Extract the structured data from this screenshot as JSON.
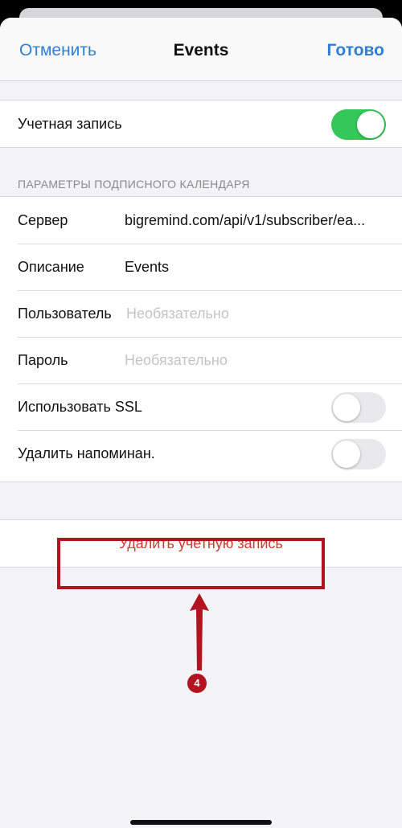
{
  "navbar": {
    "cancel_label": "Отменить",
    "title": "Events",
    "done_label": "Готово"
  },
  "account": {
    "label": "Учетная запись",
    "enabled": true
  },
  "params_section": {
    "header": "ПАРАМЕТРЫ ПОДПИСНОГО КАЛЕНДАРЯ",
    "server": {
      "label": "Сервер",
      "value": "bigremind.com/api/v1/subscriber/ea..."
    },
    "description": {
      "label": "Описание",
      "value": "Events"
    },
    "user": {
      "label": "Пользователь",
      "placeholder": "Необязательно"
    },
    "password": {
      "label": "Пароль",
      "placeholder": "Необязательно"
    },
    "ssl": {
      "label": "Использовать SSL",
      "enabled": false
    },
    "reminders": {
      "label": "Удалить напоминан.",
      "enabled": false
    }
  },
  "delete_account": {
    "label": "Удалить учетную запись"
  },
  "annotation": {
    "step": "4",
    "color": "#b3121f"
  },
  "colors": {
    "accent": "#2f7ed8",
    "toggle_on": "#34c759",
    "destructive": "#d03a32"
  }
}
